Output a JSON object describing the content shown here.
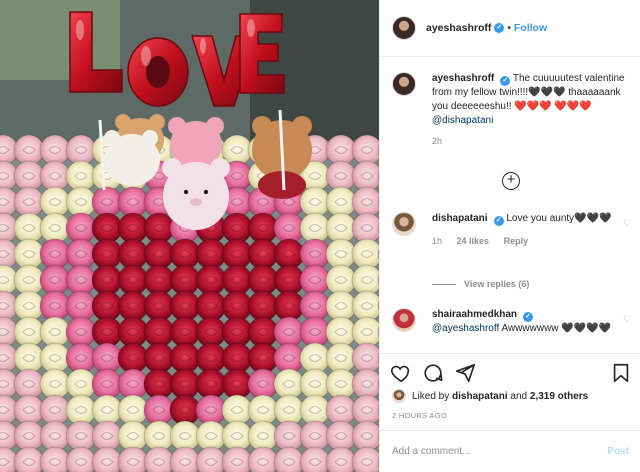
{
  "post": {
    "photo_alt": ""
  },
  "header": {
    "username": "ayeshashroff",
    "separator": "•",
    "follow_label": "Follow"
  },
  "caption": {
    "author": "ayeshashroff",
    "text": "The cuuuuutest valentine from my fellow twin!!!!🖤🖤🖤 thaaaaaank you deeeeeeshu!! ❤️❤️❤️ ❤️❤️❤️",
    "mention": "@dishapatani",
    "time": "2h"
  },
  "comments": [
    {
      "author": "dishapatani",
      "text": "Love you aunty🖤🖤🖤",
      "time": "1h",
      "likes": "24 likes",
      "reply": "Reply",
      "view_replies": "View replies (6)"
    },
    {
      "author": "shairaahmedkhan",
      "mention": "@ayeshashroff",
      "text": "Awwwwwww 🖤🖤🖤🖤"
    }
  ],
  "likes": {
    "prefix": "Liked by",
    "user": "dishapatani",
    "conj": "and",
    "others": "2,319 others"
  },
  "timestamp": "2 HOURS AGO",
  "add_comment": {
    "placeholder": "Add a comment...",
    "post_label": "Post"
  },
  "colors": {
    "accent": "#3897f0",
    "text": "#262626",
    "muted": "#8e8e8e",
    "border": "#efefef"
  }
}
